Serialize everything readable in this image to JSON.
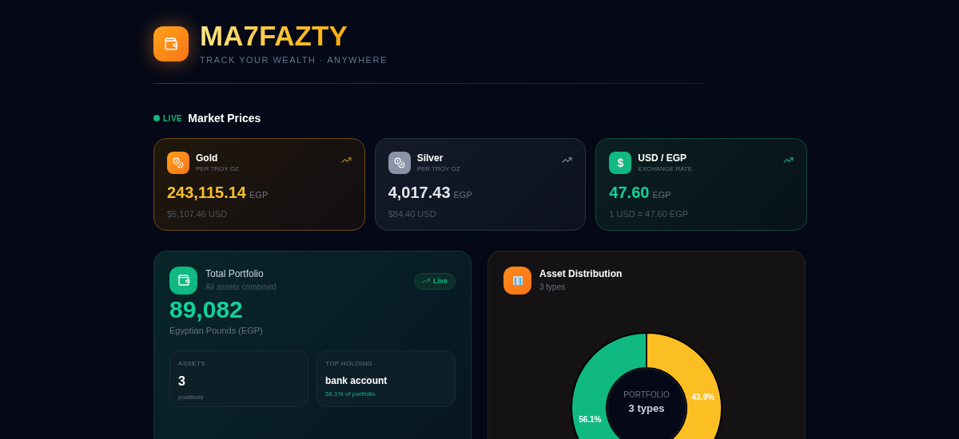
{
  "brand": {
    "title": "MA7FAZTY",
    "tagline": "TRACK YOUR WEALTH · ANYWHERE"
  },
  "market": {
    "badge": "LIVE",
    "title": "Market Prices",
    "cards": [
      {
        "kind": "gold",
        "name": "Gold",
        "unit": "PER TROY OZ",
        "price": "243,115.14",
        "currency": "EGP",
        "sub": "$5,107.46 USD"
      },
      {
        "kind": "silver",
        "name": "Silver",
        "unit": "PER TROY OZ",
        "price": "4,017.43",
        "currency": "EGP",
        "sub": "$84.40 USD"
      },
      {
        "kind": "usd",
        "symbol": "$",
        "name": "USD / EGP",
        "unit": "EXCHANGE RATE",
        "price": "47.60",
        "currency": "EGP",
        "sub": "1 USD = 47.60 EGP"
      }
    ]
  },
  "portfolio": {
    "title": "Total Portfolio",
    "subtitle": "All assets combined",
    "badge": "Live",
    "total": "89,082",
    "currency_label": "Egyptian Pounds (EGP)",
    "stats": [
      {
        "label": "ASSETS",
        "value": "3",
        "note": "positions",
        "kind": "count"
      },
      {
        "label": "TOP HOLDING",
        "value": "bank account",
        "note": "56.1% of portfolio",
        "kind": "holding"
      }
    ]
  },
  "distribution": {
    "title": "Asset Distribution",
    "subtitle": "3 types",
    "center_label": "PORTFOLIO",
    "center_value": "3 types",
    "chart_data": {
      "type": "donut",
      "series": [
        {
          "values": [
            43.9,
            56.1
          ]
        }
      ],
      "value_labels": [
        "43.9%",
        "56.1%"
      ],
      "colors": [
        "#fbbf24",
        "#10b981"
      ]
    }
  }
}
